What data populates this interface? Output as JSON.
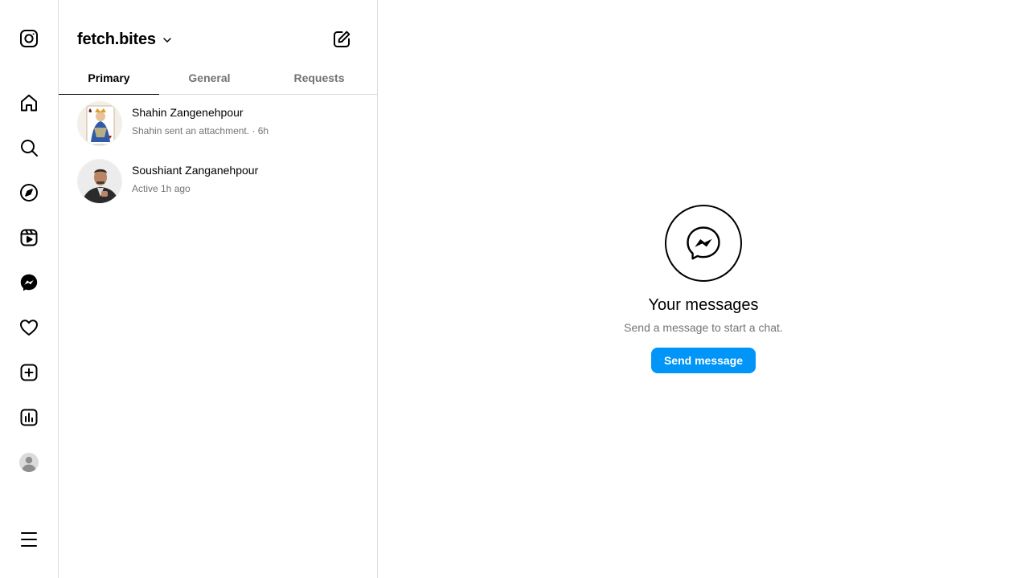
{
  "sidebar": {
    "items": [
      {
        "icon": "instagram-logo-icon"
      },
      {
        "icon": "home-icon"
      },
      {
        "icon": "search-icon"
      },
      {
        "icon": "explore-compass-icon"
      },
      {
        "icon": "reels-icon"
      },
      {
        "icon": "messenger-icon"
      },
      {
        "icon": "heart-icon"
      },
      {
        "icon": "create-plus-icon"
      },
      {
        "icon": "insights-chart-icon"
      },
      {
        "icon": "profile-avatar-icon"
      },
      {
        "icon": "menu-icon"
      }
    ]
  },
  "inbox": {
    "account_name": "fetch.bites",
    "tabs": [
      {
        "label": "Primary",
        "active": true
      },
      {
        "label": "General",
        "active": false
      },
      {
        "label": "Requests",
        "active": false
      }
    ],
    "threads": [
      {
        "name": "Shahin Zangenehpour",
        "subtitle": "Shahin sent an attachment. · 6h"
      },
      {
        "name": "Soushiant Zanganehpour",
        "subtitle": "Active 1h ago"
      }
    ]
  },
  "empty_state": {
    "title": "Your messages",
    "subtitle": "Send a message to start a chat.",
    "button_label": "Send message"
  },
  "colors": {
    "accent": "#0095f6",
    "border": "#dbdbdb",
    "secondary_text": "#737373"
  }
}
